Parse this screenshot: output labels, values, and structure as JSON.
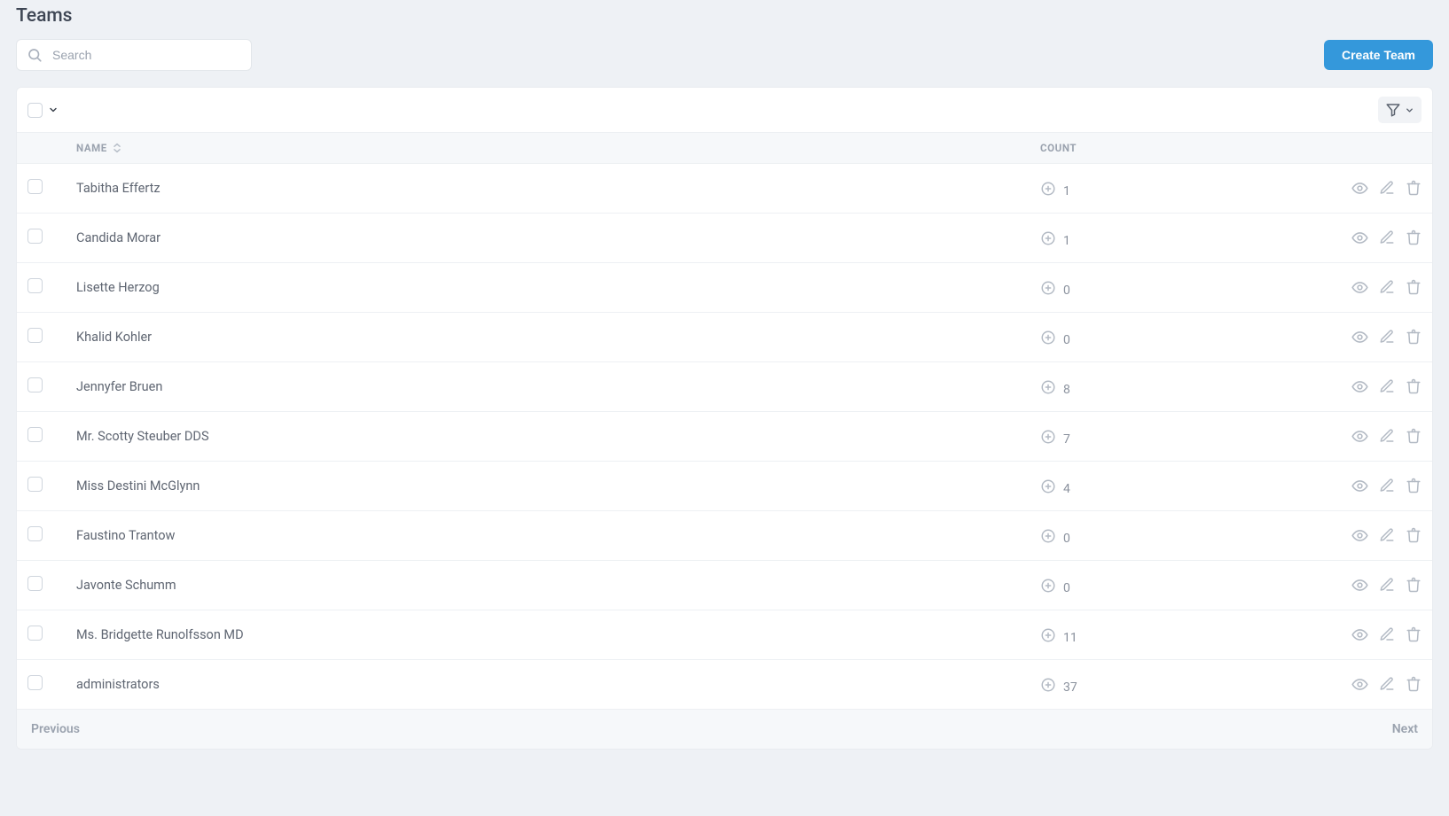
{
  "page": {
    "title": "Teams"
  },
  "search": {
    "placeholder": "Search"
  },
  "buttons": {
    "create": "Create Team"
  },
  "table": {
    "headers": {
      "name": "Name",
      "count": "Count"
    },
    "rows": [
      {
        "name": "Tabitha Effertz",
        "count": "1"
      },
      {
        "name": "Candida Morar",
        "count": "1"
      },
      {
        "name": "Lisette Herzog",
        "count": "0"
      },
      {
        "name": "Khalid Kohler",
        "count": "0"
      },
      {
        "name": "Jennyfer Bruen",
        "count": "8"
      },
      {
        "name": "Mr. Scotty Steuber DDS",
        "count": "7"
      },
      {
        "name": "Miss Destini McGlynn",
        "count": "4"
      },
      {
        "name": "Faustino Trantow",
        "count": "0"
      },
      {
        "name": "Javonte Schumm",
        "count": "0"
      },
      {
        "name": "Ms. Bridgette Runolfsson MD",
        "count": "11"
      },
      {
        "name": "administrators",
        "count": "37"
      }
    ]
  },
  "pagination": {
    "previous": "Previous",
    "next": "Next"
  }
}
